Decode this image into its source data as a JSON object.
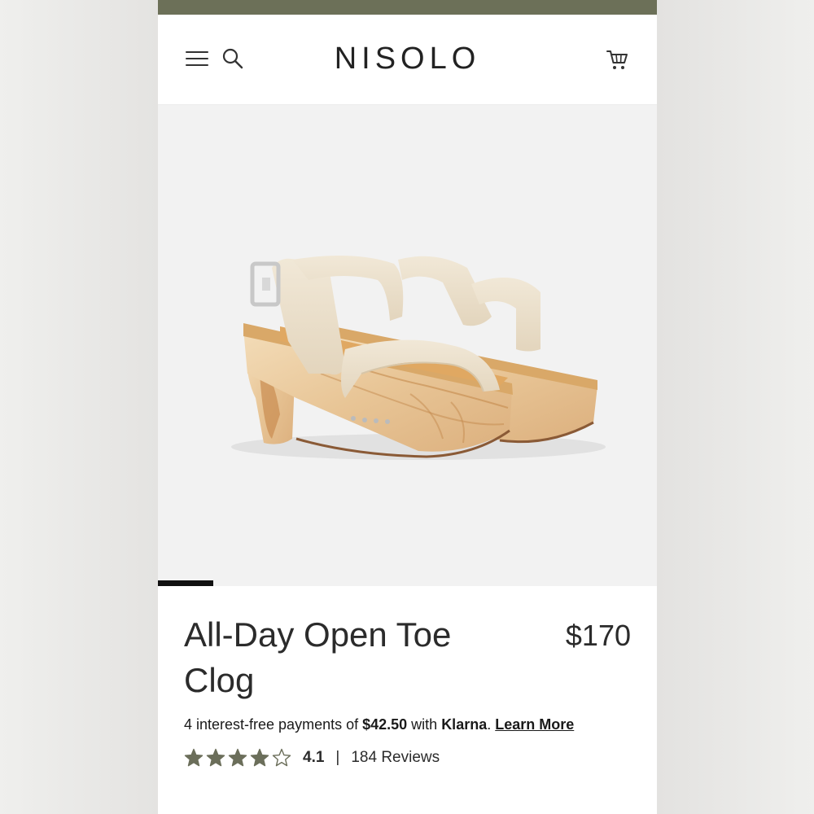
{
  "colors": {
    "topbar": "#6c7058",
    "star": "#6b6e5a",
    "text": "#2b2b2b"
  },
  "header": {
    "brand": "NISOLO",
    "menu_icon": "hamburger-menu-icon",
    "search_icon": "search-icon",
    "cart_icon": "cart-icon"
  },
  "gallery": {
    "current_image": 1
  },
  "product": {
    "title": "All-Day Open Toe Clog",
    "price": "$170",
    "klarna": {
      "prefix": "4 interest-free payments of ",
      "amount": "$42.50",
      "middle": " with ",
      "brand": "Klarna",
      "suffix": ". ",
      "learn_more": "Learn More"
    },
    "rating": {
      "value": "4.1",
      "stars_filled": 4,
      "stars_total": 5,
      "separator": "|",
      "reviews": "184 Reviews"
    }
  }
}
